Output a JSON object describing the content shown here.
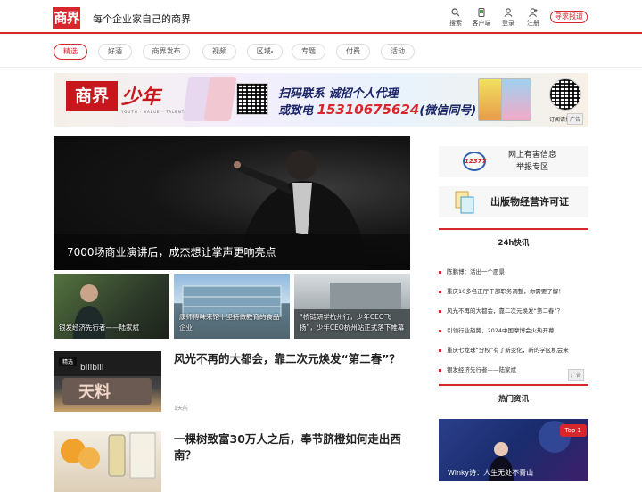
{
  "header": {
    "logo": "商界",
    "slogan": "每个企业家自己的商界",
    "tools": [
      {
        "label": "搜索",
        "icon": "search-icon"
      },
      {
        "label": "客户端",
        "icon": "phone-icon"
      },
      {
        "label": "登录",
        "icon": "user-icon"
      },
      {
        "label": "注册",
        "icon": "user-add-icon"
      }
    ],
    "seek_report": "寻求报道"
  },
  "nav": [
    "精选",
    "好酒",
    "商界发布",
    "视频",
    "区域",
    "专题",
    "付费",
    "活动"
  ],
  "banner": {
    "logo": "商界",
    "brand": "少年",
    "brand_tagline": "YOUTH · VALUE · TALENT",
    "line1": "扫码联系 诚招个人代理",
    "line2_prefix": "或致电",
    "phone": "15310675624",
    "line2_suffix": "(微信同号)",
    "subscribe": "订阅请扫码",
    "ad_label": "广告"
  },
  "hero": {
    "title": "7000场商业演讲后，成杰想让掌声更响亮点"
  },
  "tiles": [
    {
      "title": "银发经济先行者——陆家斌"
    },
    {
      "title": "康师傅味来馆丨坚持做教育的食品企业"
    },
    {
      "title": "“桥链研学杭州行，少年CEO飞扬”，少年CEO杭州站正式落下帷幕"
    }
  ],
  "articles": [
    {
      "tag": "精选",
      "title": "风光不再的大都会，靠二次元焕发“第二春”？",
      "time": "1天前"
    },
    {
      "tag": "",
      "title": "一棵树致富30万人之后，奉节脐橙如何走出西南？",
      "time": ""
    }
  ],
  "sidebar": {
    "report_box": {
      "badge": "12377",
      "line1": "网上有害信息",
      "line2": "举报专区"
    },
    "license_box": {
      "label": "出版物经营许可证"
    },
    "flash_title": "24h快讯",
    "flash": [
      "陈鹏博：活出一个愿景",
      "重庆10多名正厅干部职务调整，你需要了解！",
      "风光不再的大都会，靠二次元焕发“第二春”？",
      "引领行业趋势，2024中国摩博会火热开幕",
      "重庆七龙珠“分校”有了新变化，新的学区机会来",
      "银发经济先行者——陆家斌"
    ],
    "ad_label": "广告",
    "hot_title": "热门资讯",
    "hot_badge": "Top 1",
    "hot_caption": "Winky诗：人生无处不青山"
  },
  "colors": {
    "accent": "#d8262d",
    "banner_text": "#1a2466"
  }
}
